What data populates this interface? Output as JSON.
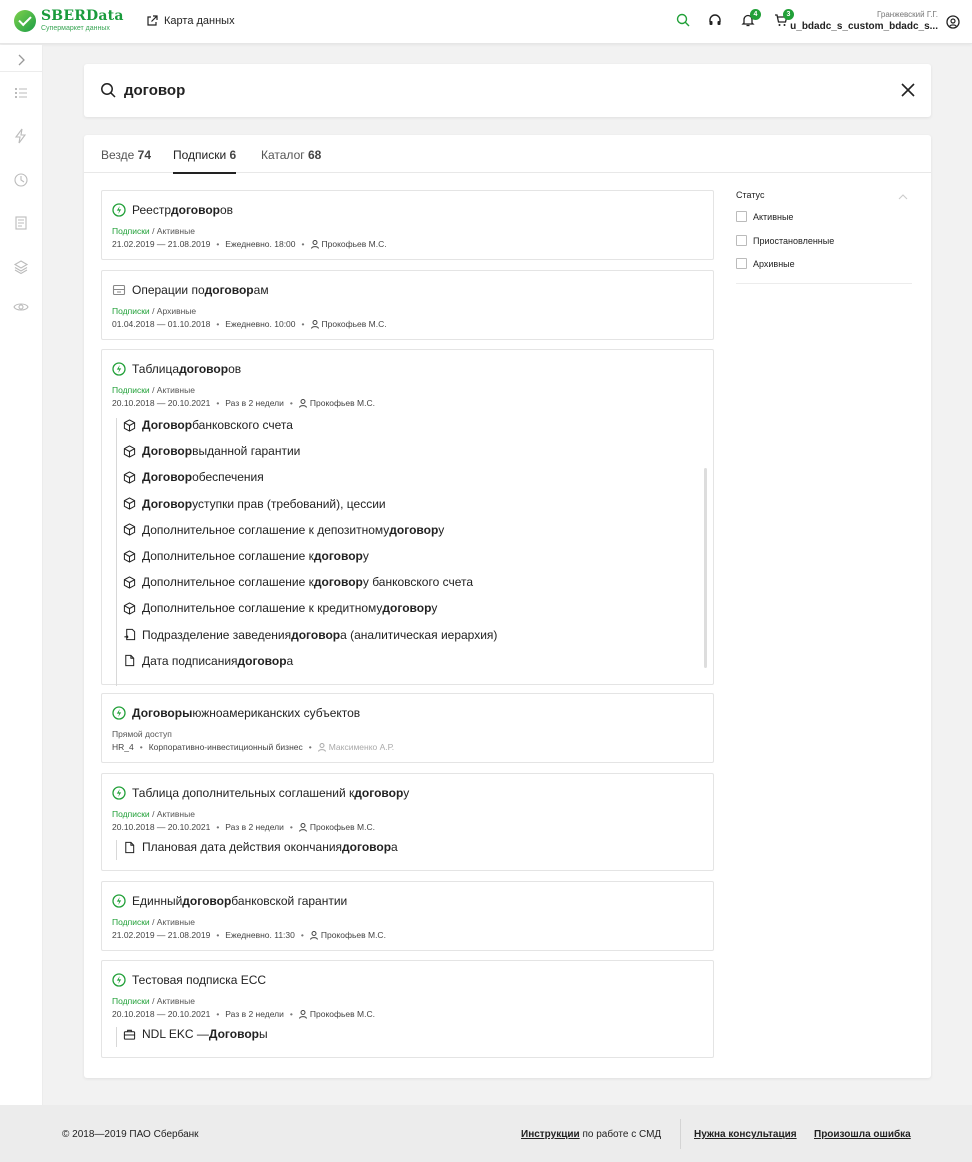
{
  "header": {
    "logo_title": "SBERData",
    "logo_sub": "Супермаркет данных",
    "map_link": "Карта данных",
    "notifications_count": "4",
    "cart_count": "3",
    "user_name": "Гранжевский Г.Г.",
    "user_login": "u_bdadc_s_custom_bdadc_s...",
    "accent_color": "#21a038"
  },
  "search": {
    "value": "договор"
  },
  "tabs": [
    {
      "label": "Везде",
      "count": "74"
    },
    {
      "label": "Подписки",
      "count": "6"
    },
    {
      "label": "Каталог",
      "count": "68"
    }
  ],
  "results": [
    {
      "title": [
        {
          "t": "Реестр "
        },
        {
          "t": "договор",
          "b": true
        },
        {
          "t": "ов"
        }
      ],
      "crumb_1": "Подписки",
      "crumb_2": "/ Активные",
      "meta": [
        "21.02.2019 — 21.08.2019",
        "Ежедневно. 18:00",
        "Прокофьев М.С."
      ]
    },
    {
      "title": [
        {
          "t": "Операции по "
        },
        {
          "t": "договор",
          "b": true
        },
        {
          "t": "ам"
        }
      ],
      "crumb_1": "Подписки",
      "crumb_2": "/ Архивные",
      "meta": [
        "01.04.2018 — 01.10.2018",
        "Ежедневно. 10:00",
        "Прокофьев М.С."
      ]
    },
    {
      "title": [
        {
          "t": "Таблица "
        },
        {
          "t": "договор",
          "b": true
        },
        {
          "t": "ов"
        }
      ],
      "crumb_1": "Подписки",
      "crumb_2": "/ Активные",
      "meta": [
        "20.10.2018 — 20.10.2021",
        "Раз в 2 недели",
        "Прокофьев М.С."
      ],
      "subs": [
        [
          {
            "t": "Договор",
            "b": true
          },
          {
            "t": " банковского счета"
          }
        ],
        [
          {
            "t": "Договор",
            "b": true
          },
          {
            "t": " выданной гарантии"
          }
        ],
        [
          {
            "t": "Договор",
            "b": true
          },
          {
            "t": " обеспечения"
          }
        ],
        [
          {
            "t": "Договор",
            "b": true
          },
          {
            "t": " уступки прав (требований), цессии"
          }
        ],
        [
          {
            "t": "Дополнительное соглашение к депозитному "
          },
          {
            "t": "договор",
            "b": true
          },
          {
            "t": "у"
          }
        ],
        [
          {
            "t": "Дополнительное соглашение к "
          },
          {
            "t": "договор",
            "b": true
          },
          {
            "t": "у"
          }
        ],
        [
          {
            "t": "Дополнительное соглашение к "
          },
          {
            "t": "договор",
            "b": true
          },
          {
            "t": "у банковского счета"
          }
        ],
        [
          {
            "t": "Дополнительное соглашение к кредитному "
          },
          {
            "t": "договор",
            "b": true
          },
          {
            "t": "у"
          }
        ],
        [
          {
            "t": "Подразделение заведения "
          },
          {
            "t": "договор",
            "b": true
          },
          {
            "t": "а (аналитическая иерархия)"
          }
        ],
        [
          {
            "t": "Дата подписания "
          },
          {
            "t": "договор",
            "b": true
          },
          {
            "t": "а"
          }
        ]
      ]
    },
    {
      "title": [
        {
          "t": "Договоры",
          "b": true
        },
        {
          "t": " южноамериканских субъектов"
        }
      ],
      "crumb_1": "Прямой доступ",
      "crumb_2": "",
      "meta": [
        "HR_4",
        "Корпоративно-инвестиционный бизнес",
        "Максименко А.Р."
      ]
    },
    {
      "title": [
        {
          "t": "Таблица дополнительных соглашений к "
        },
        {
          "t": "договор",
          "b": true
        },
        {
          "t": "у"
        }
      ],
      "crumb_1": "Подписки",
      "crumb_2": "/ Активные",
      "meta": [
        "20.10.2018 — 20.10.2021",
        "Раз в 2 недели",
        "Прокофьев М.С."
      ],
      "subs": [
        [
          {
            "t": "Плановая дата действия окончания "
          },
          {
            "t": "договор",
            "b": true
          },
          {
            "t": "а"
          }
        ]
      ]
    },
    {
      "title": [
        {
          "t": "Единный "
        },
        {
          "t": "договор",
          "b": true
        },
        {
          "t": " банковской гарантии"
        }
      ],
      "crumb_1": "Подписки",
      "crumb_2": "/ Активные",
      "meta": [
        "21.02.2019 — 21.08.2019",
        "Ежедневно. 11:30",
        "Прокофьев М.С."
      ]
    },
    {
      "title": [
        {
          "t": "Тестовая подписка ЕСС"
        }
      ],
      "crumb_1": "Подписки",
      "crumb_2": "/ Активные",
      "meta": [
        "20.10.2018 — 20.10.2021",
        "Раз в 2 недели",
        "Прокофьев М.С."
      ],
      "subs": [
        [
          {
            "t": "NDL EKC — "
          },
          {
            "t": "Договор",
            "b": true
          },
          {
            "t": "ы"
          }
        ]
      ]
    }
  ],
  "filters": {
    "title": "Статус",
    "options": [
      "Активные",
      "Приостановленные",
      "Архивные"
    ]
  },
  "footer": {
    "copyright": "© 2018—2019 ПАО Сбербанк",
    "instructions_link": "Инструкции",
    "instructions_rest": " по работе с СМД",
    "consult_link": "Нужна консультация",
    "error_link": "Произошла ошибка"
  }
}
